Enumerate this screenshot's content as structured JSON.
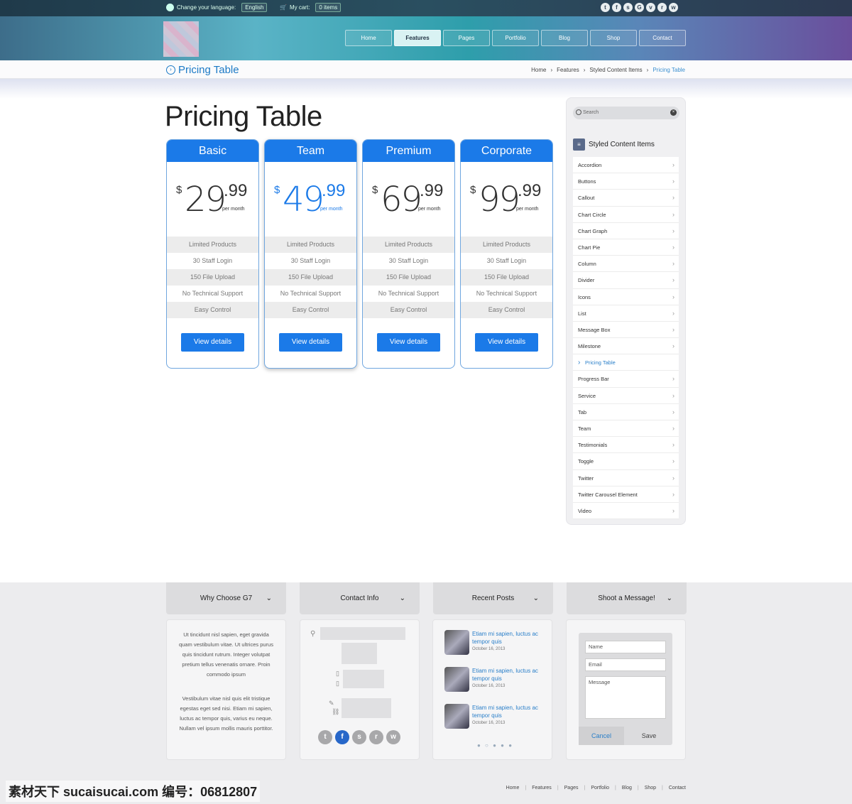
{
  "topbar": {
    "lang_label": "Change your language:",
    "lang_value": "English",
    "cart_label": "My cart:",
    "cart_value": "0 items",
    "social": [
      "t",
      "f",
      "s",
      "G",
      "v",
      "r",
      "w"
    ]
  },
  "nav": [
    "Home",
    "Features",
    "Pages",
    "Portfolio",
    "Blog",
    "Shop",
    "Contact"
  ],
  "page_title": "Pricing Table",
  "breadcrumb": [
    "Home",
    "Features",
    "Styled Content Items",
    "Pricing Table"
  ],
  "heading": "Pricing Table",
  "plans": [
    {
      "name": "Basic",
      "currency": "$",
      "int": "29",
      "dec": ".99",
      "per": "per month"
    },
    {
      "name": "Team",
      "currency": "$",
      "int": "49",
      "dec": ".99",
      "per": "per month"
    },
    {
      "name": "Premium",
      "currency": "$",
      "int": "69",
      "dec": ".99",
      "per": "per month"
    },
    {
      "name": "Corporate",
      "currency": "$",
      "int": "99",
      "dec": ".99",
      "per": "per month"
    }
  ],
  "features": [
    "Limited Products",
    "30 Staff Login",
    "150 File Upload",
    "No Technical Support",
    "Easy Control"
  ],
  "view_details": "View details",
  "sidebar": {
    "search_placeholder": "Search",
    "heading": "Styled Content Items",
    "items": [
      "Accordion",
      "Buttons",
      "Callout",
      "Chart Circle",
      "Chart Graph",
      "Chart Pie",
      "Column",
      "Divider",
      "Icons",
      "List",
      "Message Box",
      "Milestone",
      "Pricing Table",
      "Progress Bar",
      "Service",
      "Tab",
      "Team",
      "Testimonials",
      "Toggle",
      "Twitter",
      "Twitter Carousel Element",
      "Video"
    ]
  },
  "footer": {
    "tabs": [
      "Why Choose G7",
      "Contact Info",
      "Recent Posts",
      "Shoot a Message!"
    ],
    "why_p1": "Ut tincidunt nisl sapien, eget gravida quam vestibulum vitae. Ut ultrices purus quis tincidunt rutrum. Integer volutpat pretium tellus venenatis ornare. Proin commodo ipsum",
    "why_p2": "Vestibulum vitae nisl quis elit tristique egestas eget sed nisi. Etiam mi sapien, luctus ac tempor quis, varius eu neque. Nullam vel ipsum mollis mauris porttitor.",
    "posts": [
      {
        "title": "Etiam mi sapien, luctus ac tempor quis",
        "date": "October 16, 2013"
      },
      {
        "title": "Etiam mi sapien, luctus ac tempor quis",
        "date": "October 16, 2013"
      },
      {
        "title": "Etiam mi sapien, luctus ac tempor quis",
        "date": "October 16, 2013"
      }
    ],
    "form": {
      "name": "Name",
      "email": "Email",
      "message": "Message",
      "cancel": "Cancel",
      "save": "Save"
    },
    "nav": [
      "Home",
      "Features",
      "Pages",
      "Portfolio",
      "Blog",
      "Shop",
      "Contact"
    ],
    "watermark": "素材天下 sucaisucai.com  编号：06812807"
  }
}
